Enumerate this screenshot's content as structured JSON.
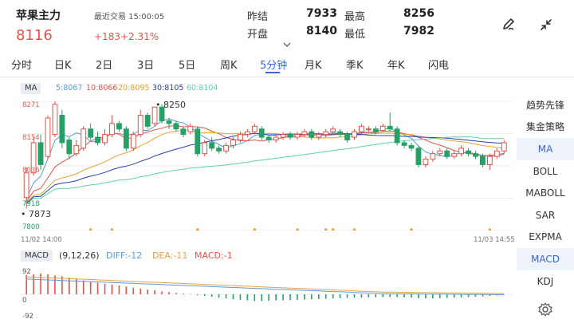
{
  "header": {
    "title": "苹果主力",
    "last_trade_label": "最近交易 15:00:05",
    "price": "8116",
    "change": "+183",
    "change_pct": "+2.31%",
    "quotes": [
      {
        "label": "昨结",
        "value": "7933"
      },
      {
        "label": "最高",
        "value": "8256"
      },
      {
        "label": "开盘",
        "value": "8140"
      },
      {
        "label": "最低",
        "value": "7982"
      }
    ],
    "icons": [
      "pencil-icon",
      "shrink-icon"
    ]
  },
  "tabs": [
    "分时",
    "日K",
    "2日",
    "3日",
    "5日",
    "周K",
    "5分钟",
    "月K",
    "季K",
    "年K",
    "闪电"
  ],
  "active_tab": "5分钟",
  "ma_legend": {
    "tag": "MA",
    "items": [
      {
        "text": "5:8067",
        "color": "#5b9bd5"
      },
      {
        "text": "10:8066",
        "color": "#e0534a"
      },
      {
        "text": "20:8095",
        "color": "#e8a23a"
      },
      {
        "text": "30:8105",
        "color": "#2a3fa8"
      },
      {
        "text": "60:8104",
        "color": "#5ed0b0"
      }
    ]
  },
  "price_axis": {
    "labels": [
      "8271",
      "8154",
      "8036",
      "7918",
      "7800"
    ],
    "high_marker": "8250",
    "low_marker": "7873"
  },
  "time_axis": {
    "start": "11/02 14:00",
    "end": "11/03 14:55"
  },
  "macd_legend": {
    "tag": "MACD",
    "params": "(9,12,26)",
    "items": [
      {
        "text": "DIFF:-12",
        "color": "#5b9bd5"
      },
      {
        "text": "DEA:-11",
        "color": "#e8a23a"
      },
      {
        "text": "MACD:-1",
        "color": "#e0534a"
      }
    ]
  },
  "macd_axis": {
    "top": "92",
    "zero": "0",
    "bottom": "-92"
  },
  "right_panel": {
    "items": [
      "趋势先锋",
      "集金策略",
      "MA",
      "BOLL",
      "MABOLL",
      "SAR",
      "EXPMA",
      "MACD",
      "KDJ"
    ],
    "active": [
      "MA",
      "MACD"
    ]
  },
  "colors": {
    "up": "#e0534a",
    "down": "#27a067",
    "accent": "#3a67d8"
  },
  "chart_data": {
    "type": "candlestick",
    "ylim": [
      7800,
      8271
    ],
    "candles": [
      [
        7920,
        8010,
        7880,
        8030
      ],
      [
        8010,
        8120,
        8000,
        8140
      ],
      [
        8120,
        8040,
        8020,
        8150
      ],
      [
        8070,
        8210,
        8060,
        8220
      ],
      [
        8150,
        8260,
        8140,
        8271
      ],
      [
        8220,
        8120,
        8100,
        8240
      ],
      [
        8130,
        8080,
        8060,
        8140
      ],
      [
        8080,
        8110,
        8070,
        8130
      ],
      [
        8100,
        8170,
        8090,
        8180
      ],
      [
        8170,
        8140,
        8130,
        8190
      ],
      [
        8140,
        8120,
        8110,
        8160
      ],
      [
        8120,
        8150,
        8110,
        8170
      ],
      [
        8150,
        8190,
        8140,
        8220
      ],
      [
        8190,
        8170,
        8160,
        8200
      ],
      [
        8170,
        8100,
        8090,
        8180
      ],
      [
        8100,
        8150,
        8090,
        8160
      ],
      [
        8150,
        8220,
        8140,
        8240
      ],
      [
        8220,
        8180,
        8170,
        8230
      ],
      [
        8190,
        8250,
        8180,
        8250
      ],
      [
        8250,
        8200,
        8190,
        8260
      ],
      [
        8200,
        8190,
        8170,
        8210
      ],
      [
        8190,
        8170,
        8160,
        8200
      ],
      [
        8170,
        8150,
        8140,
        8180
      ],
      [
        8160,
        8180,
        8150,
        8190
      ],
      [
        8170,
        8080,
        8070,
        8180
      ],
      [
        8080,
        8120,
        8070,
        8130
      ],
      [
        8120,
        8100,
        8090,
        8140
      ],
      [
        8100,
        8090,
        8080,
        8110
      ],
      [
        8090,
        8110,
        8080,
        8120
      ],
      [
        8110,
        8130,
        8100,
        8140
      ],
      [
        8130,
        8150,
        8120,
        8160
      ],
      [
        8150,
        8160,
        8140,
        8170
      ],
      [
        8160,
        8180,
        8150,
        8190
      ],
      [
        8170,
        8140,
        8130,
        8180
      ],
      [
        8140,
        8130,
        8120,
        8150
      ],
      [
        8130,
        8140,
        8120,
        8150
      ],
      [
        8140,
        8150,
        8130,
        8160
      ],
      [
        8150,
        8140,
        8130,
        8160
      ],
      [
        8140,
        8150,
        8130,
        8160
      ],
      [
        8150,
        8160,
        8140,
        8170
      ],
      [
        8160,
        8140,
        8130,
        8170
      ],
      [
        8140,
        8150,
        8130,
        8160
      ],
      [
        8150,
        8160,
        8140,
        8170
      ],
      [
        8160,
        8170,
        8150,
        8180
      ],
      [
        8160,
        8150,
        8140,
        8170
      ],
      [
        8150,
        8130,
        8120,
        8160
      ],
      [
        8140,
        8160,
        8130,
        8170
      ],
      [
        8160,
        8180,
        8150,
        8190
      ],
      [
        8170,
        8170,
        8160,
        8180
      ],
      [
        8170,
        8160,
        8150,
        8180
      ],
      [
        8165,
        8180,
        8160,
        8190
      ],
      [
        8180,
        8170,
        8160,
        8230
      ],
      [
        8170,
        8120,
        8110,
        8180
      ],
      [
        8120,
        8110,
        8100,
        8130
      ],
      [
        8110,
        8100,
        8090,
        8120
      ],
      [
        8100,
        8040,
        8030,
        8110
      ],
      [
        8040,
        8060,
        8030,
        8070
      ],
      [
        8060,
        8080,
        8050,
        8090
      ],
      [
        8080,
        8090,
        8070,
        8100
      ],
      [
        8090,
        8070,
        8060,
        8100
      ],
      [
        8070,
        8080,
        8060,
        8090
      ],
      [
        8080,
        8100,
        8070,
        8110
      ],
      [
        8090,
        8080,
        8070,
        8100
      ],
      [
        8080,
        8070,
        8060,
        8090
      ],
      [
        8070,
        8040,
        8030,
        8080
      ],
      [
        8040,
        8070,
        8020,
        8080
      ],
      [
        8070,
        8090,
        8060,
        8100
      ],
      [
        8090,
        8120,
        8080,
        8130
      ]
    ],
    "macd_bars": [
      70,
      72,
      75,
      72,
      68,
      65,
      60,
      55,
      50,
      46,
      42,
      38,
      35,
      32,
      28,
      24,
      20,
      17,
      14,
      11,
      8,
      5,
      3,
      1,
      -3,
      -6,
      -9,
      -12,
      -15,
      -18,
      -20,
      -22,
      -24,
      -24,
      -23,
      -22,
      -22,
      -21,
      -20,
      -19,
      -18,
      -17,
      -16,
      -15,
      -14,
      -13,
      -12,
      -12,
      -11,
      -11,
      -10,
      -10,
      -10,
      -11,
      -12,
      -14,
      -15,
      -15,
      -14,
      -13,
      -12,
      -11,
      -10,
      -9,
      -8,
      -6,
      -4,
      -1
    ]
  }
}
